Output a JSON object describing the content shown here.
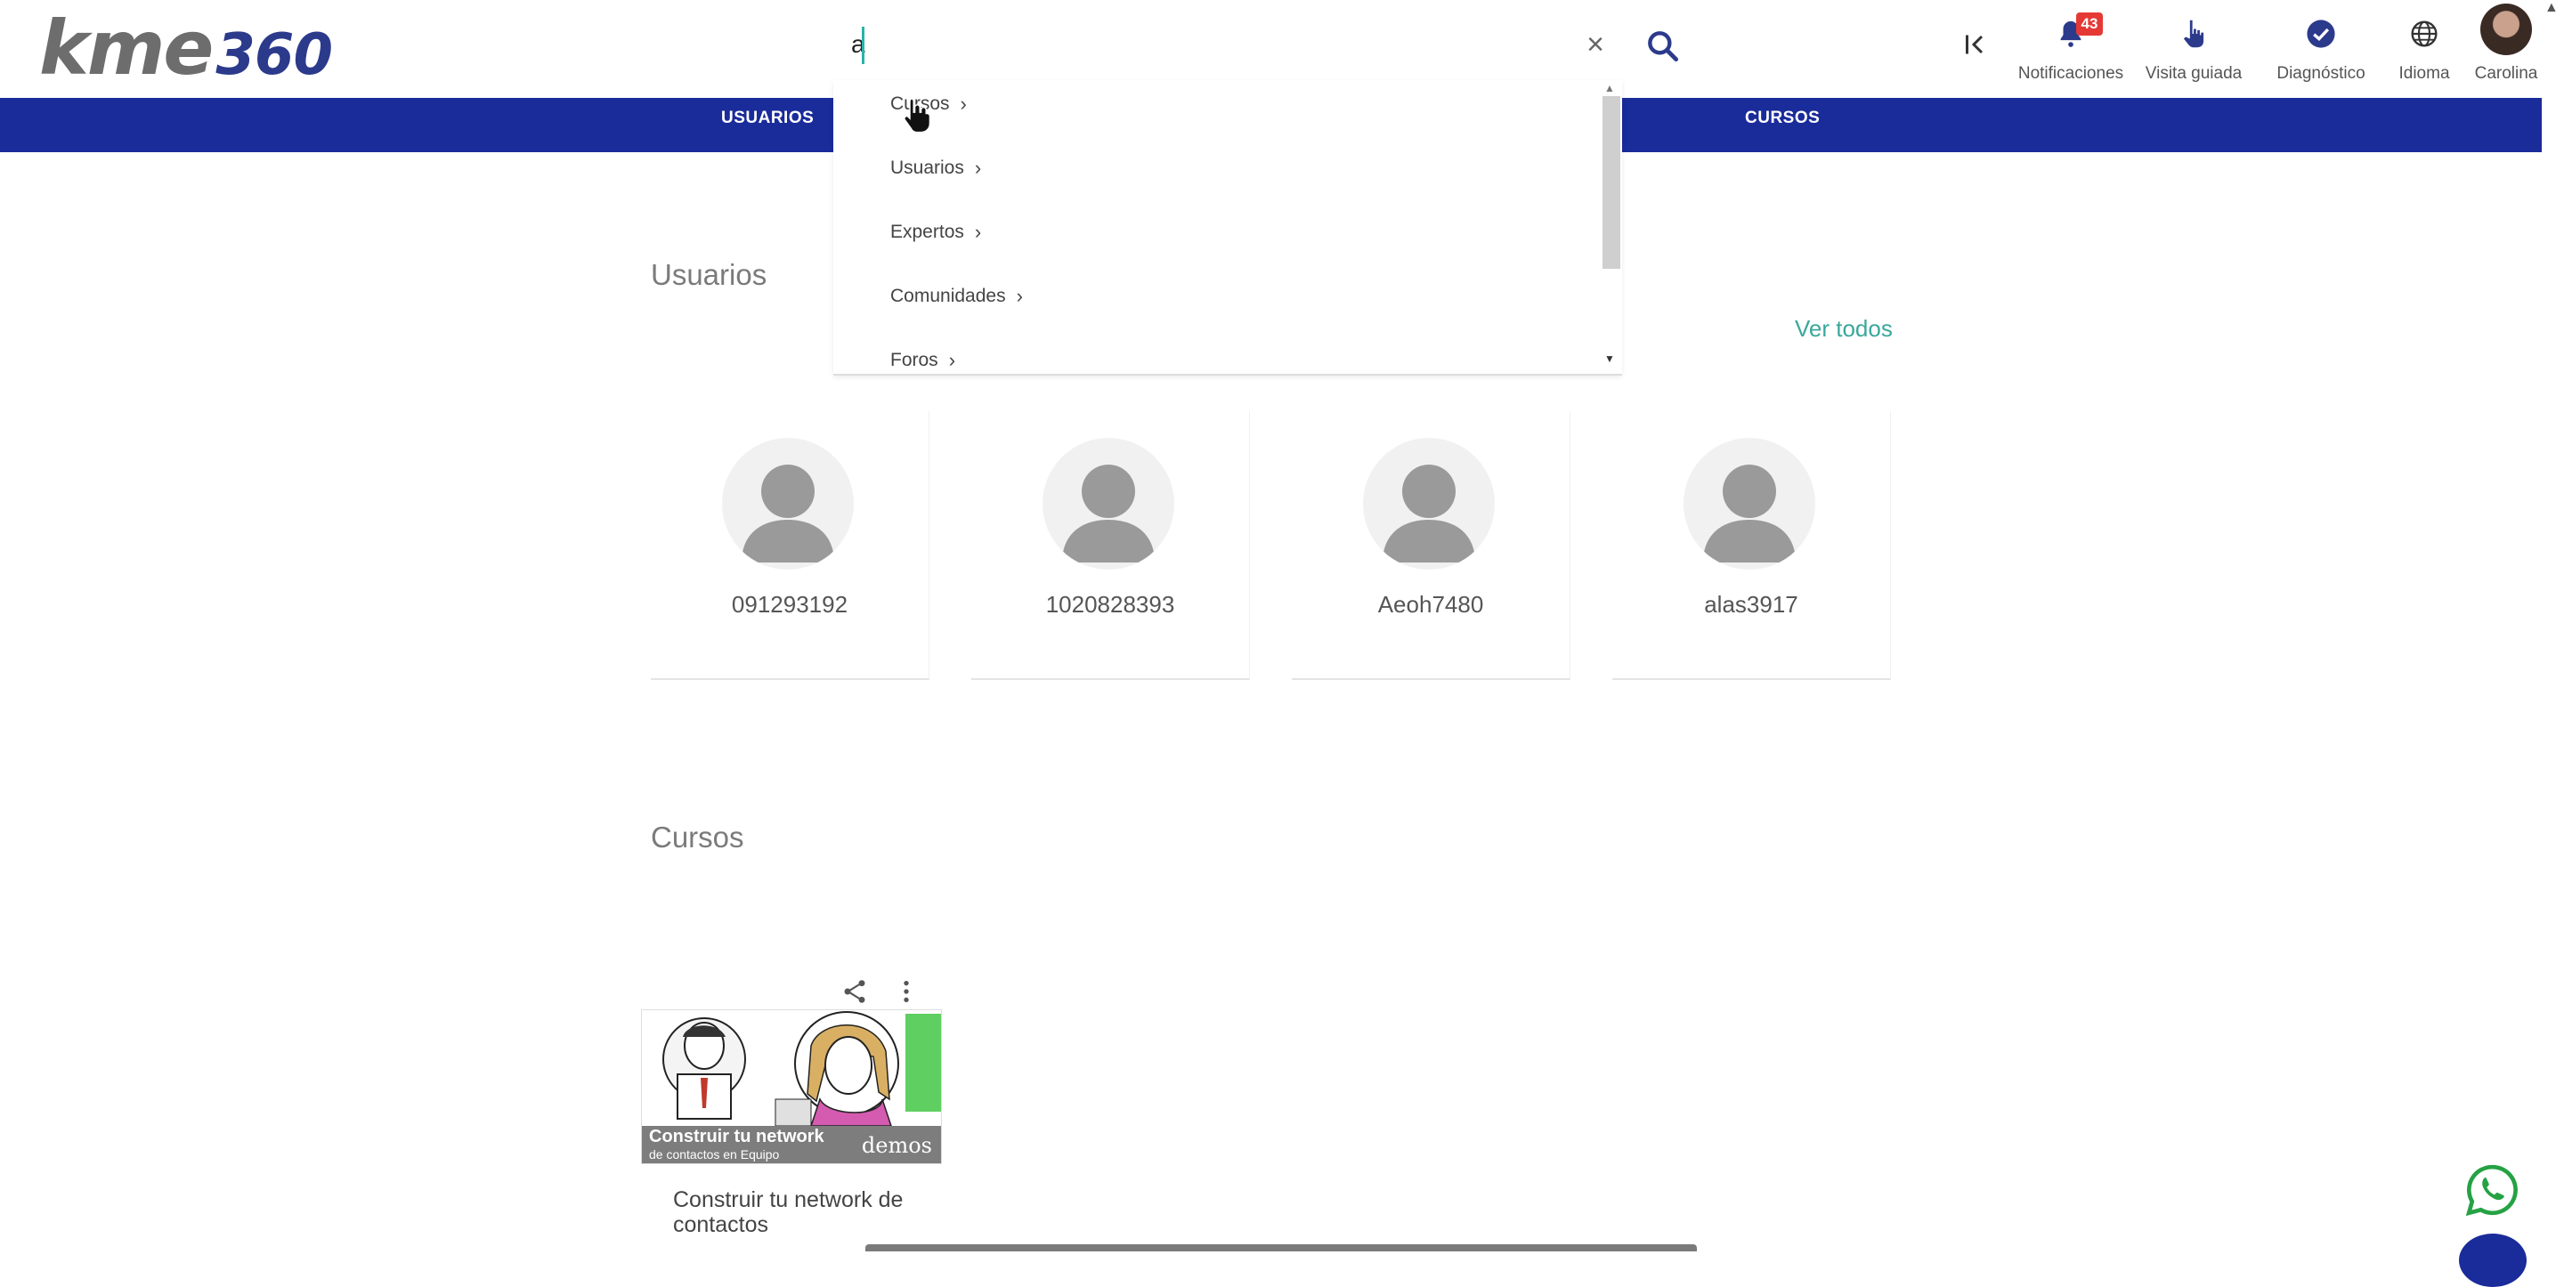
{
  "header": {
    "logo_main": "kme",
    "logo_num": "360",
    "search_value": "a",
    "items": [
      {
        "label": "Notificaciones",
        "icon": "bell-icon"
      },
      {
        "label": "Visita guiada",
        "icon": "hand-pointer-icon"
      },
      {
        "label": "Diagnóstico",
        "icon": "check-circle-icon"
      },
      {
        "label": "Idioma",
        "icon": "globe-icon"
      },
      {
        "label": "Carolina",
        "icon": "avatar"
      }
    ],
    "notification_count": "43"
  },
  "nav": {
    "items": [
      "USUARIOS",
      "CURSOS"
    ]
  },
  "dropdown": {
    "items": [
      "Cursos",
      "Usuarios",
      "Expertos",
      "Comunidades",
      "Foros"
    ]
  },
  "usuarios": {
    "title": "Usuarios",
    "ver_todos": "Ver todos",
    "users": [
      "091293192",
      "1020828393",
      "Aeoh7480",
      "alas3917"
    ]
  },
  "cursos": {
    "title": "Cursos",
    "course_title": "Construir tu network de contactos",
    "image_caption_line1": "Construir tu network",
    "image_caption_line2": "de contactos en Equipo",
    "image_brand": "demos"
  },
  "colors": {
    "navbar": "#1a2b9a",
    "accent_link": "#3aa79c",
    "badge": "#e53935"
  }
}
